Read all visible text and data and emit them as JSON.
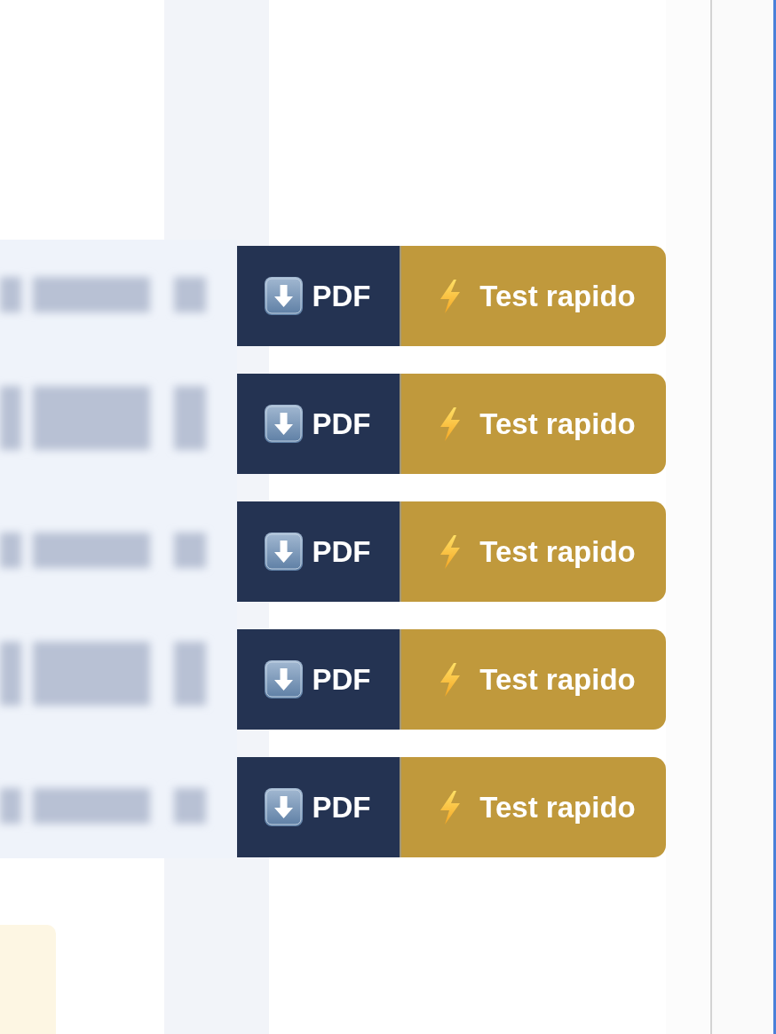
{
  "rows": [
    {
      "pdf_button": {
        "label": "PDF"
      },
      "test_button": {
        "label": "Test rapido"
      }
    },
    {
      "pdf_button": {
        "label": "PDF"
      },
      "test_button": {
        "label": "Test rapido"
      }
    },
    {
      "pdf_button": {
        "label": "PDF"
      },
      "test_button": {
        "label": "Test rapido"
      }
    },
    {
      "pdf_button": {
        "label": "PDF"
      },
      "test_button": {
        "label": "Test rapido"
      }
    },
    {
      "pdf_button": {
        "label": "PDF"
      },
      "test_button": {
        "label": "Test rapido"
      }
    }
  ]
}
